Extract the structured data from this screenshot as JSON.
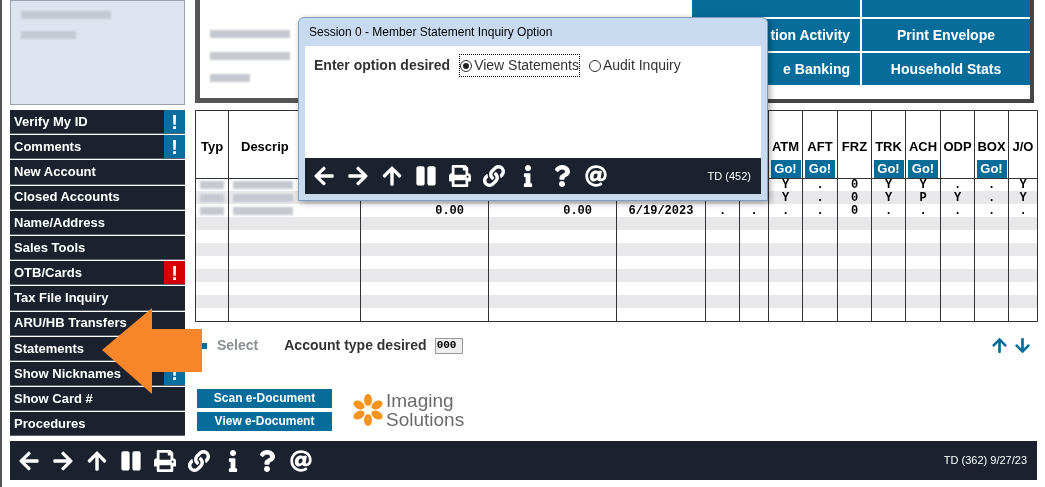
{
  "sidebar": {
    "items": [
      {
        "label": "Verify My ID",
        "badge": {
          "text": "!",
          "color": "#0a6f9f"
        }
      },
      {
        "label": "Comments",
        "badge": {
          "text": "!",
          "color": "#0a6f9f"
        }
      },
      {
        "label": "New Account"
      },
      {
        "label": "Closed Accounts"
      },
      {
        "label": "Name/Address"
      },
      {
        "label": "Sales Tools"
      },
      {
        "label": "OTB/Cards",
        "badge": {
          "text": "!",
          "color": "#d40000"
        }
      },
      {
        "label": "Tax File Inquiry"
      },
      {
        "label": "ARU/HB Transfers"
      },
      {
        "label": "Statements"
      },
      {
        "label": "Show Nicknames",
        "badge": {
          "text": "!",
          "color": "#0a6f9f"
        }
      },
      {
        "label": "Show Card #"
      },
      {
        "label": "Procedures"
      }
    ]
  },
  "quick_buttons": [
    {
      "label": "tion Activity"
    },
    {
      "label": "Print Envelope"
    },
    {
      "label": "e Banking"
    },
    {
      "label": "Household Stats"
    }
  ],
  "dialog": {
    "title": "Session 0  - Member Statement Inquiry Option",
    "prompt": "Enter option desired",
    "options": [
      {
        "label": "View Statements",
        "selected": true
      },
      {
        "label": "Audit Inquiry",
        "selected": false
      }
    ],
    "status": "TD (452)"
  },
  "table": {
    "columns": [
      {
        "label": "Typ"
      },
      {
        "label": "Descrip"
      },
      {},
      {},
      {},
      {},
      {},
      {
        "label": "ATM",
        "button": "Go!"
      },
      {
        "label": "AFT",
        "button": "Go!"
      },
      {
        "label": "FRZ"
      },
      {
        "label": "TRK",
        "button": "Go!"
      },
      {
        "label": "ACH",
        "button": "Go!"
      },
      {
        "label": "ODP"
      },
      {
        "label": "BOX",
        "button": "Go!"
      },
      {
        "label": "J/O"
      }
    ],
    "rows": [
      {
        "redacted": true,
        "cells": [
          null,
          null,
          null,
          null,
          null,
          null,
          null,
          "Y",
          ".",
          "0",
          "Y",
          "Y",
          ".",
          ".",
          "Y"
        ]
      },
      {
        "redacted": true,
        "cells": [
          null,
          null,
          null,
          null,
          null,
          null,
          null,
          "Y",
          ".",
          "0",
          "Y",
          "P",
          "Y",
          ".",
          "Y"
        ]
      },
      {
        "redacted": true,
        "cells": [
          null,
          null,
          "0.00",
          "0.00",
          "6/19/2023",
          ".",
          ".",
          ".",
          ".",
          "0",
          ".",
          ".",
          ".",
          ".",
          "."
        ]
      }
    ]
  },
  "select_link": {
    "label": "Select",
    "disabled": true
  },
  "account_type": {
    "label": "Account type desired",
    "value": "000"
  },
  "document_buttons": [
    {
      "label": "Scan e-Document"
    },
    {
      "label": "View e-Document"
    }
  ],
  "logo": {
    "lines": [
      "Imaging",
      "Solutions"
    ]
  },
  "status_bar": {
    "text": "TD (362) 9/27/23"
  }
}
